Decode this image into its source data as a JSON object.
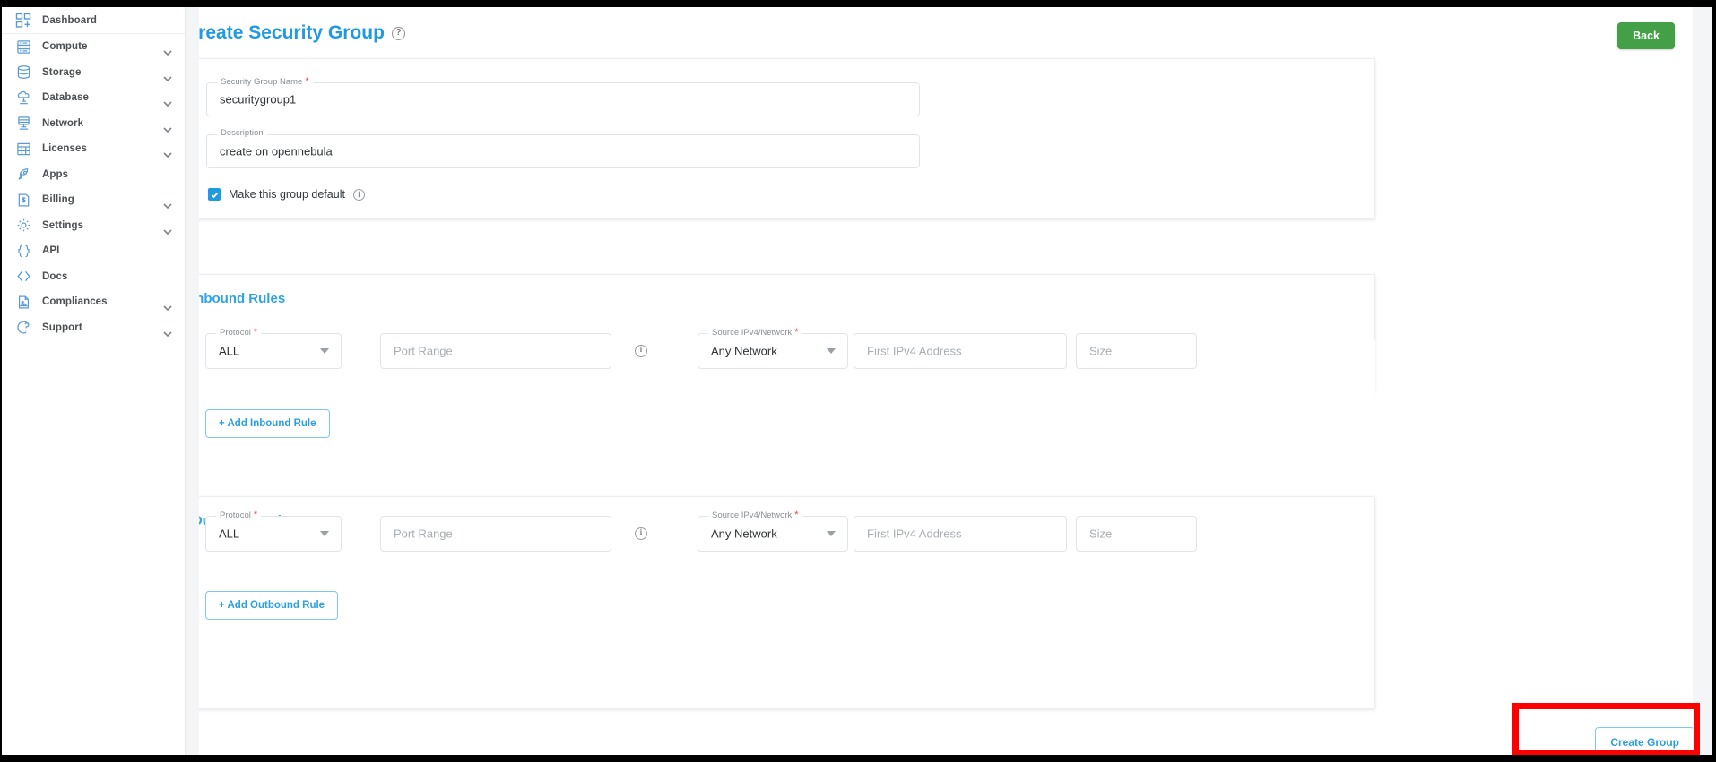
{
  "sidebar": {
    "items": [
      {
        "label": "Dashboard",
        "icon": "dashboard-add-icon",
        "expandable": false
      },
      {
        "label": "Compute",
        "icon": "server-icon",
        "expandable": true
      },
      {
        "label": "Storage",
        "icon": "database-stack-icon",
        "expandable": true
      },
      {
        "label": "Database",
        "icon": "database-cloud-icon",
        "expandable": true
      },
      {
        "label": "Network",
        "icon": "network-icon",
        "expandable": true
      },
      {
        "label": "Licenses",
        "icon": "grid-table-icon",
        "expandable": true
      },
      {
        "label": "Apps",
        "icon": "rocket-icon",
        "expandable": false
      },
      {
        "label": "Billing",
        "icon": "invoice-dollar-icon",
        "expandable": true
      },
      {
        "label": "Settings",
        "icon": "gear-icon",
        "expandable": true
      },
      {
        "label": "API",
        "icon": "braces-icon",
        "expandable": false
      },
      {
        "label": "Docs",
        "icon": "code-angle-icon",
        "expandable": false
      },
      {
        "label": "Compliances",
        "icon": "document-icon",
        "expandable": true
      },
      {
        "label": "Support",
        "icon": "lifebuoy-icon",
        "expandable": true
      }
    ]
  },
  "header": {
    "title": "Create Security Group",
    "help_icon": "question-mark-icon",
    "help_glyph": "?",
    "back_label": "Back"
  },
  "details": {
    "name_field": {
      "label": "Security Group Name",
      "required": true,
      "value": "securitygroup1"
    },
    "description_field": {
      "label": "Description",
      "required": false,
      "value": "create on opennebula"
    },
    "default_checkbox": {
      "label": "Make this group default",
      "checked": true,
      "info_icon": "info-icon",
      "info_glyph": "i"
    }
  },
  "inbound": {
    "title": "Inbound Rules",
    "protocol": {
      "label": "Protocol",
      "required": true,
      "value": "ALL"
    },
    "port_range": {
      "placeholder": "Port Range",
      "value": ""
    },
    "port_info_icon": "info-icon",
    "port_info_glyph": "i",
    "source": {
      "label": "Source IPv4/Network",
      "required": true,
      "value": "Any Network"
    },
    "first_ipv4": {
      "placeholder": "First IPv4 Address",
      "value": ""
    },
    "size": {
      "placeholder": "Size",
      "value": ""
    },
    "add_label": "+ Add Inbound Rule"
  },
  "outbound": {
    "title": "Outbound Rules",
    "protocol": {
      "label": "Protocol",
      "required": true,
      "value": "ALL"
    },
    "port_range": {
      "placeholder": "Port Range",
      "value": ""
    },
    "port_info_icon": "info-icon",
    "port_info_glyph": "i",
    "source": {
      "label": "Source IPv4/Network",
      "required": true,
      "value": "Any Network"
    },
    "first_ipv4": {
      "placeholder": "First IPv4 Address",
      "value": ""
    },
    "size": {
      "placeholder": "Size",
      "value": ""
    },
    "add_label": "+ Add Outbound Rule"
  },
  "footer": {
    "create_label": "Create Group"
  },
  "colors": {
    "accent_blue": "#1f9ae0",
    "section_blue": "#2da3e5",
    "back_green": "#43a047",
    "required_red": "#f44336",
    "annotation_red": "#ff0000",
    "sidebar_icon": "#5b9bd5"
  }
}
